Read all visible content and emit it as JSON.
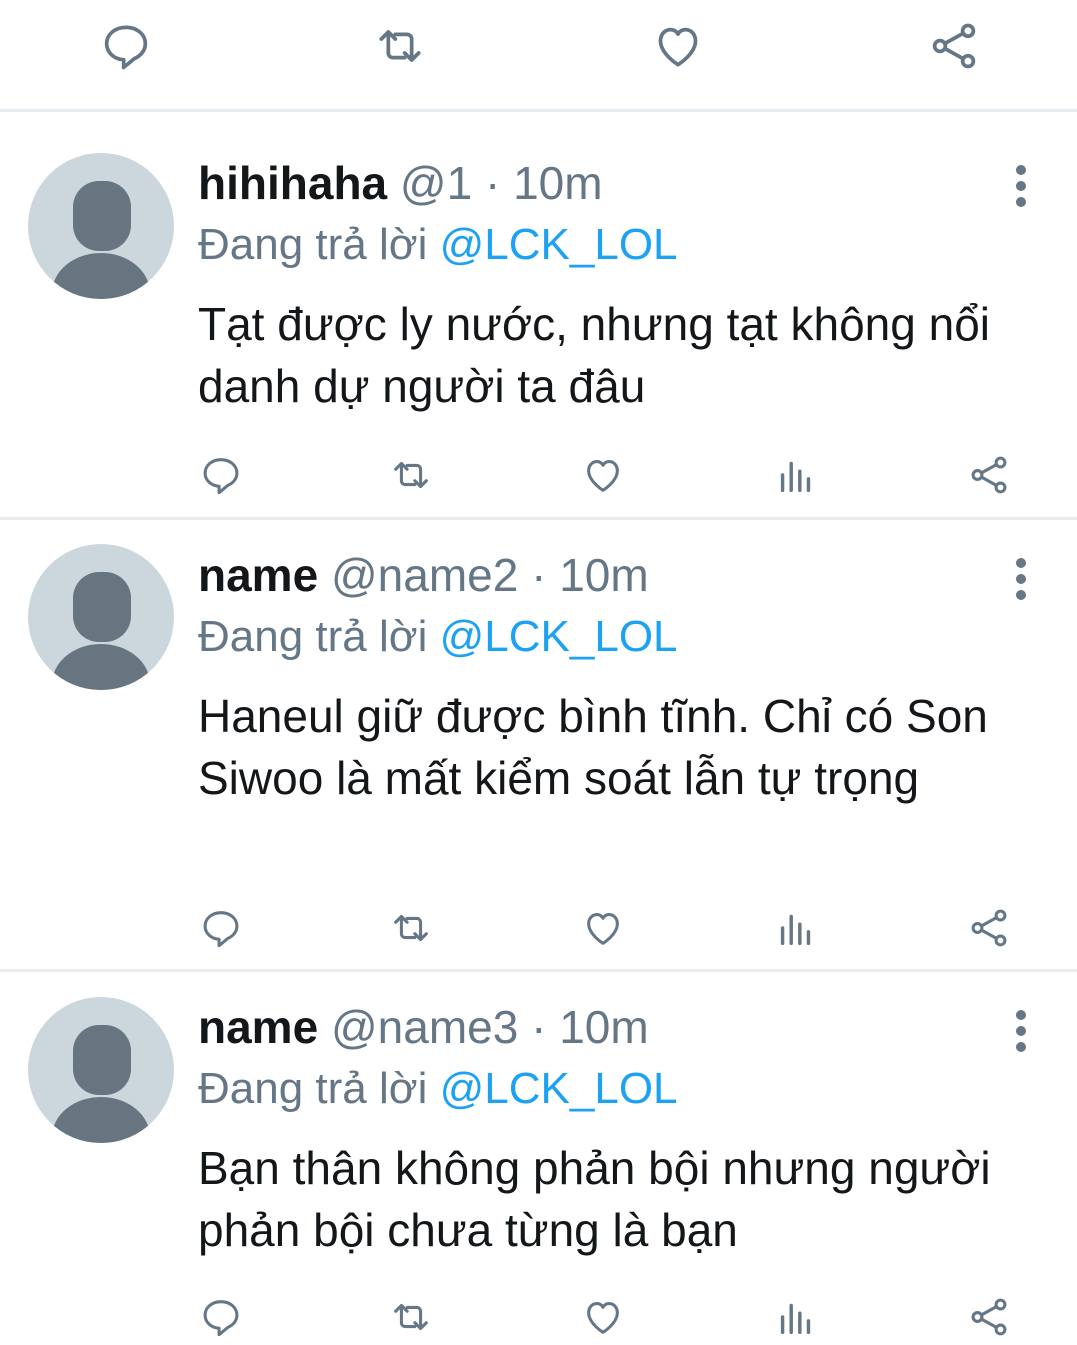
{
  "top_actions": {
    "icons": [
      "reply-icon",
      "retweet-icon",
      "like-icon",
      "share-icon"
    ]
  },
  "tweets": [
    {
      "display_name": "hihihaha",
      "handle": "@1",
      "separator": "·",
      "time": "10m",
      "reply_prefix": "Đang trả lời",
      "reply_to": "@LCK_LOL",
      "text": "Tạt được ly nước, nhưng tạt không nổi danh dự người ta đâu"
    },
    {
      "display_name": "name",
      "handle": "@name2",
      "separator": "·",
      "time": "10m",
      "reply_prefix": "Đang trả lời",
      "reply_to": "@LCK_LOL",
      "text": "Haneul giữ được bình tĩnh. Chỉ có Son Siwoo là mất kiểm soát lẫn tự trọng"
    },
    {
      "display_name": "name",
      "handle": "@name3",
      "separator": "·",
      "time": "10m",
      "reply_prefix": "Đang trả lời",
      "reply_to": "@LCK_LOL",
      "text": "Bạn thân không phản bội nhưng người phản bội chưa từng là bạn"
    }
  ],
  "colors": {
    "icon": "#657786",
    "mention": "#1da1f2",
    "divider": "#e6ecf0",
    "avatar_bg": "#ccd6dd"
  }
}
